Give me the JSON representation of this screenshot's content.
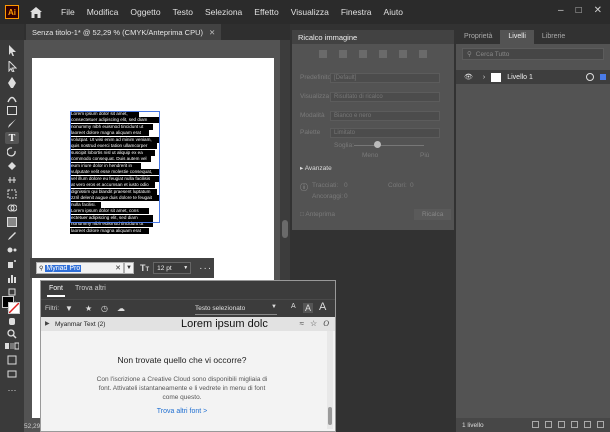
{
  "app": {
    "logo_text": "Ai"
  },
  "menu": [
    "File",
    "Modifica",
    "Oggetto",
    "Testo",
    "Seleziona",
    "Effetto",
    "Visualizza",
    "Finestra",
    "Aiuto"
  ],
  "document": {
    "tab_title": "Senza titolo-1* @ 52,29 % (CMYK/Anteprima CPU)",
    "zoom_status": "52,29"
  },
  "text_content": [
    "Lorem ipsum dolor sit amet,",
    "consectetuer adipiscing elit, sed diam",
    "nonummy nibh euismod tincidunt ut",
    "laoreet dolore magna aliquam erat",
    "volutpat. Ut wisi enim ad minim veniam,",
    "quis nostrud exerci tation ullamcorper",
    "suscipit lobortis nisl ut aliquip ex ea",
    "commodo consequat. Duis autem vel",
    "eum iriure dolor in hendrerit in",
    "vulputate velit esse molestie consequat,",
    "vel illum dolore eu feugiat nulla facilisis",
    "at vero eros et accumsan et iusto odio",
    "dignissim qui blandit praesent luptatum",
    "zzril delenit augue duis dolore te feugait",
    "nulla facilisi.",
    "Lorem ipsum dolor sit amet, cons",
    "ectetuer adipiscing elit, sed diam",
    "nonummy nibh euismod tincidunt ut",
    "laoreet dolore magna aliquam erat"
  ],
  "image_trace": {
    "title": "Ricalco immagine",
    "rows": [
      {
        "label": "Predefinito",
        "value": "[Default]"
      },
      {
        "label": "Visualizza",
        "value": "Risultato di ricalco"
      },
      {
        "label": "Modalità",
        "value": "Bianco e nero"
      },
      {
        "label": "Palette",
        "value": "Limitato"
      }
    ],
    "threshold_label": "Soglia:",
    "threshold_min": "Meno",
    "threshold_max": "Più",
    "advanced_label": "Avanzate",
    "paths_label": "Tracciati:",
    "paths_value": "0",
    "colors_label": "Colori:",
    "colors_value": "0",
    "anchors_label": "Ancoraggi:",
    "anchors_value": "0",
    "preview_label": "Anteprima",
    "trace_button": "Ricalca"
  },
  "layers": {
    "tabs": [
      "Proprietà",
      "Livelli",
      "Librerie"
    ],
    "search_placeholder": "Cerca Tutto",
    "layer_name": "Livello 1",
    "footer_count": "1 livello"
  },
  "font_bar": {
    "font_name": "Myriad Pro",
    "size": "12 pt"
  },
  "font_panel": {
    "tabs": [
      "Font",
      "Trova altri"
    ],
    "filter_label": "Filtri:",
    "sample_label": "Testo selezionato",
    "item_name": "Myanmar Text (2)",
    "item_preview": "Lorem ipsum dolc",
    "msg_title": "Non trovate quello che vi occorre?",
    "msg_body": "Con l'iscrizione a Creative Cloud sono disponibili migliaia di font. Attivateli istantaneamente e li vedrete in menu di font come questo.",
    "link": "Trova altri font >"
  }
}
